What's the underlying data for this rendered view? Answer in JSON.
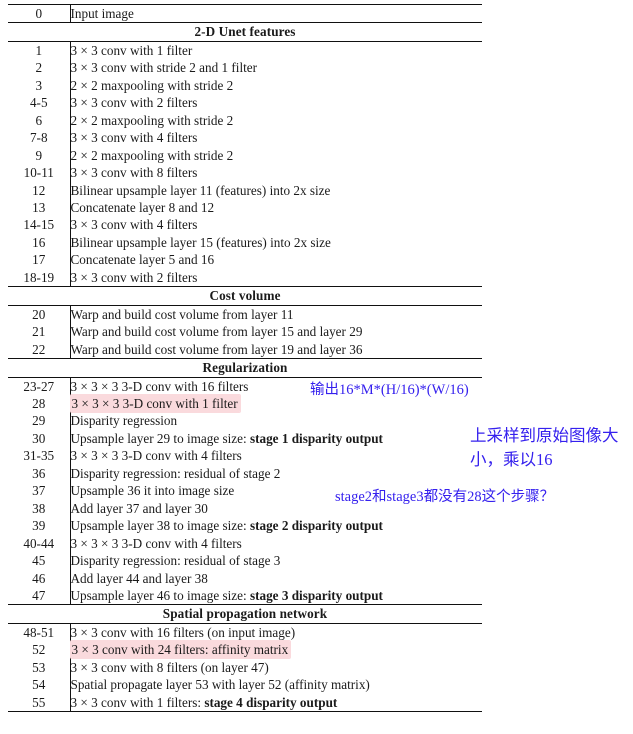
{
  "table": {
    "rows": [
      {
        "kind": "row",
        "id": "0",
        "desc": "Input image"
      },
      {
        "kind": "section",
        "label": "2-D Unet features"
      },
      {
        "kind": "row",
        "id": "1",
        "desc": "3 × 3 conv with 1 filter"
      },
      {
        "kind": "row",
        "id": "2",
        "desc": "3 × 3 conv with stride 2 and 1 filter"
      },
      {
        "kind": "row",
        "id": "3",
        "desc": "2 × 2 maxpooling with stride 2"
      },
      {
        "kind": "row",
        "id": "4-5",
        "desc": "3 × 3 conv with 2 filters"
      },
      {
        "kind": "row",
        "id": "6",
        "desc": "2 × 2 maxpooling with stride 2"
      },
      {
        "kind": "row",
        "id": "7-8",
        "desc": "3 × 3 conv with 4 filters"
      },
      {
        "kind": "row",
        "id": "9",
        "desc": "2 × 2 maxpooling with stride 2"
      },
      {
        "kind": "row",
        "id": "10-11",
        "desc": "3 × 3 conv with 8 filters"
      },
      {
        "kind": "row",
        "id": "12",
        "desc": "Bilinear upsample layer 11 (features) into 2x size"
      },
      {
        "kind": "row",
        "id": "13",
        "desc": "Concatenate layer 8 and 12"
      },
      {
        "kind": "row",
        "id": "14-15",
        "desc": "3 × 3 conv with 4 filters"
      },
      {
        "kind": "row",
        "id": "16",
        "desc": "Bilinear upsample layer 15 (features) into 2x size"
      },
      {
        "kind": "row",
        "id": "17",
        "desc": "Concatenate layer 5 and 16"
      },
      {
        "kind": "row",
        "id": "18-19",
        "desc": "3 × 3 conv with 2 filters"
      },
      {
        "kind": "section",
        "label": "Cost volume"
      },
      {
        "kind": "row",
        "id": "20",
        "desc": "Warp and build cost volume from layer 11"
      },
      {
        "kind": "row",
        "id": "21",
        "desc": "Warp and build cost volume from layer 15 and layer 29"
      },
      {
        "kind": "row",
        "id": "22",
        "desc": "Warp and build cost volume from layer 19 and layer 36"
      },
      {
        "kind": "section",
        "label": "Regularization"
      },
      {
        "kind": "row",
        "id": "23-27",
        "desc": "3 × 3 × 3 3-D conv with 16 filters"
      },
      {
        "kind": "row",
        "id": "28",
        "desc": "3 × 3 × 3 3-D conv with 1 filter",
        "highlight": true
      },
      {
        "kind": "row",
        "id": "29",
        "desc": "Disparity regression"
      },
      {
        "kind": "row",
        "id": "30",
        "desc": "Upsample layer 29 to image size: ",
        "bold": "stage 1 disparity output"
      },
      {
        "kind": "row",
        "id": "31-35",
        "desc": "3 × 3 × 3 3-D conv with 4 filters"
      },
      {
        "kind": "row",
        "id": "36",
        "desc": "Disparity regression: residual of stage 2"
      },
      {
        "kind": "row",
        "id": "37",
        "desc": "Upsample 36 it into image size"
      },
      {
        "kind": "row",
        "id": "38",
        "desc": "Add layer 37 and layer 30"
      },
      {
        "kind": "row",
        "id": "39",
        "desc": "Upsample layer 38 to image size: ",
        "bold": "stage 2 disparity output"
      },
      {
        "kind": "row",
        "id": "40-44",
        "desc": "3 × 3 × 3 3-D conv with 4 filters"
      },
      {
        "kind": "row",
        "id": "45",
        "desc": "Disparity regression: residual of stage 3"
      },
      {
        "kind": "row",
        "id": "46",
        "desc": "Add layer 44 and layer 38"
      },
      {
        "kind": "row",
        "id": "47",
        "desc": "Upsample layer 46 to image size: ",
        "bold": "stage 3 disparity output"
      },
      {
        "kind": "section",
        "label": "Spatial propagation network"
      },
      {
        "kind": "row",
        "id": "48-51",
        "desc": "3 × 3 conv with 16 filters (on input image)"
      },
      {
        "kind": "row",
        "id": "52",
        "desc": "3 × 3 conv with 24 filters: affinity matrix",
        "highlight": true
      },
      {
        "kind": "row",
        "id": "53",
        "desc": "3 × 3 conv with 8 filters (on layer 47)"
      },
      {
        "kind": "row",
        "id": "54",
        "desc": "Spatial propagate layer 53 with layer 52 (affinity matrix)"
      },
      {
        "kind": "row",
        "id": "55",
        "desc": "3 × 3 conv with 1 filters: ",
        "bold": "stage 4 disparity output"
      }
    ]
  },
  "annotations": {
    "output_shape": "输出16*M*(H/16)*(W/16)",
    "upsample_note": "上采样到原始图像大小，乘以16",
    "stage_question": "stage2和stage3都没有28这个步骤？"
  },
  "colors": {
    "annotation_ink": "#3520ee",
    "highlight": "#fadadd",
    "rule": "#111111",
    "text": "#1a1a1a"
  }
}
